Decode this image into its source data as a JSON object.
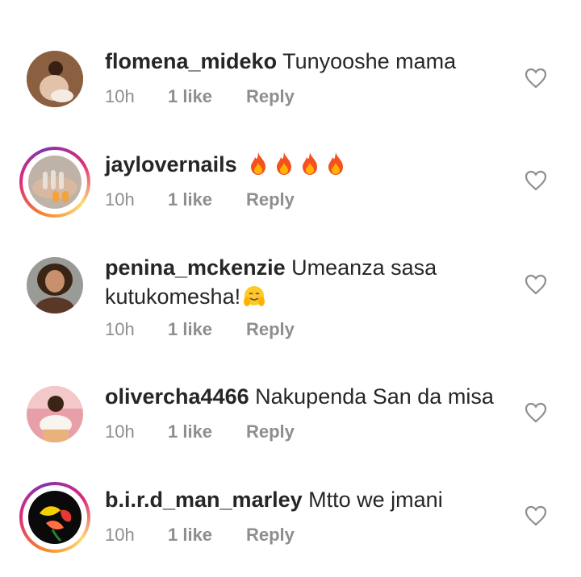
{
  "comments": [
    {
      "username": "flomena_mideko",
      "text": "Tunyooshe mama",
      "time": "10h",
      "likes": "1 like",
      "reply": "Reply",
      "avatar_icon": "profile-photo",
      "story_ring": false
    },
    {
      "username": "jaylovernails",
      "text": "🔥🔥🔥🔥",
      "time": "10h",
      "likes": "1 like",
      "reply": "Reply",
      "avatar_icon": "nails-photo",
      "story_ring": true
    },
    {
      "username": "penina_mckenzie",
      "text": "Umeanza sasa",
      "text_line2": "kutukomesha!",
      "time": "10h",
      "likes": "1 like",
      "reply": "Reply",
      "avatar_icon": "profile-photo",
      "story_ring": false
    },
    {
      "username": "olivercha4466",
      "text": "Nakupenda San da misa",
      "time": "10h",
      "likes": "1 like",
      "reply": "Reply",
      "avatar_icon": "profile-photo",
      "story_ring": false
    },
    {
      "username": "b.i.r.d_man_marley",
      "text": "Mtto we jmani",
      "time": "10h",
      "likes": "1 like",
      "reply": "Reply",
      "avatar_icon": "flower-photo",
      "story_ring": true
    }
  ],
  "colors": {
    "username": "#262626",
    "meta": "#8e8e8e",
    "heart_outline": "#8e8e8e"
  }
}
